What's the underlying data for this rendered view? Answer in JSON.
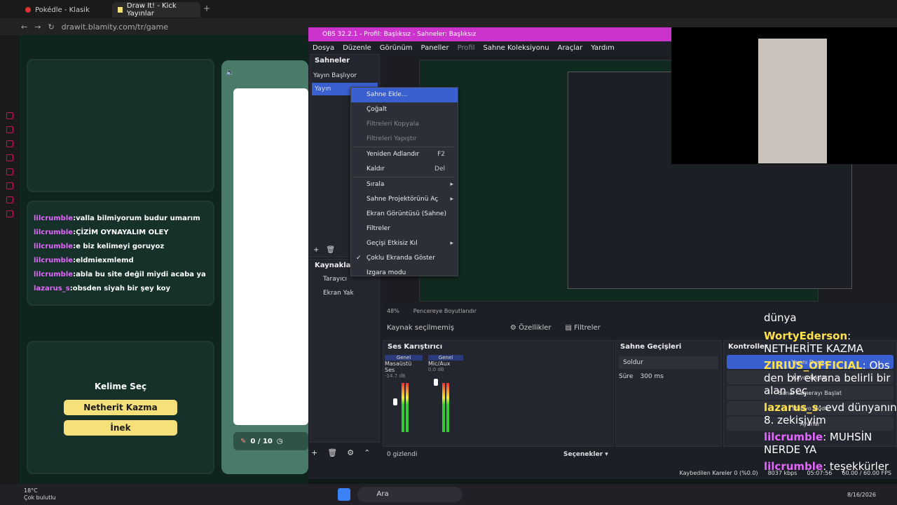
{
  "browser": {
    "tabs": [
      {
        "label": "Pokédle - Klasik"
      },
      {
        "label": "Draw It! - Kick Yayınlar"
      }
    ],
    "url": "drawit.blamity.com/tr/game"
  },
  "game": {
    "chat": [
      {
        "user": "lilcrumble",
        "text": "valla bilmiyorum budur umarım"
      },
      {
        "user": "lilcrumble",
        "text": "ÇİZİM OYNAYALIM OLEY"
      },
      {
        "user": "lilcrumble",
        "text": "e biz kelimeyi goruyoz"
      },
      {
        "user": "lilcrumble",
        "text": "eldmiexmlemd"
      },
      {
        "user": "lilcrumble",
        "text": "abla bu site değil miydi acaba ya"
      },
      {
        "user": "lazarus_s",
        "text": "obsden siyah bir şey koy"
      }
    ],
    "choose_title": "Kelime Seç",
    "words": [
      "Netherit Kazma",
      "İnek"
    ],
    "counter": "0 / 10"
  },
  "obs": {
    "title": "OBS 32.2.1 - Profil: Başlıksız - Sahneler: Başlıksız",
    "menu": [
      "Dosya",
      "Düzenle",
      "Görünüm",
      "Paneller",
      "Profil",
      "Sahne Koleksiyonu",
      "Araçlar",
      "Yardım"
    ],
    "scenes_title": "Sahneler",
    "scenes": [
      "Yayın Başlıyor",
      "Yayın"
    ],
    "sources_title": "Kaynaklar",
    "sources": [
      "Tarayıcı",
      "Ekran Yak"
    ],
    "context_menu": [
      {
        "label": "Sahne Ekle...",
        "state": "sel"
      },
      {
        "label": "Çoğalt"
      },
      {
        "label": "Filtreleri Kopyala",
        "state": "dis"
      },
      {
        "label": "Filtreleri Yapıştır",
        "state": "dis"
      },
      {
        "label": "Yeniden Adlandır",
        "shortcut": "F2"
      },
      {
        "label": "Kaldır",
        "shortcut": "Del"
      },
      {
        "label": "Sırala",
        "submenu": true
      },
      {
        "label": "Sahne Projektörünü Aç",
        "submenu": true
      },
      {
        "label": "Ekran Görüntüsü (Sahne)"
      },
      {
        "label": "Filtreler"
      },
      {
        "label": "Geçişi Etkisiz Kıl",
        "submenu": true
      },
      {
        "label": "Çoklu Ekranda Göster",
        "check": true
      },
      {
        "label": "Izgara modu"
      }
    ],
    "zoom": "48%",
    "fit": "Pencereye Boyutlandır",
    "no_source": "Kaynak seçilmemiş",
    "props": "Özellikler",
    "filters": "Filtreler",
    "mixer_title": "Ses Karıştırıcı",
    "mixer": [
      {
        "group": "Genel",
        "name": "Masaüstü Ses",
        "db": "-14.7 dB"
      },
      {
        "group": "Genel",
        "name": "Mic/Aux",
        "db": "0.0 dB"
      }
    ],
    "hidden": "0 gizlendi",
    "options": "Seçenekler",
    "transitions_title": "Sahne Geçişleri",
    "transition": "Soldur",
    "duration_label": "Süre",
    "duration": "300 ms",
    "controls_title": "Kontroller",
    "controls": [
      "Yayını Durdur",
      "Kaydı Başlat",
      "Sanal Kamerayı Başlat",
      "Stüdyo Modu",
      "Ayarlar"
    ],
    "status": {
      "dropped": "Kaybedilen Kareler 0 (%0.0)",
      "kbps": "8037 kbps",
      "time": "05:07:56",
      "fps": "60.00 / 60.00 FPS"
    }
  },
  "overlay_chat": [
    {
      "user": "",
      "text": "dünya"
    },
    {
      "user": "WortyEderson",
      "text": "NETHERİTE KAZMA",
      "color": "yellow"
    },
    {
      "user": "ZIRIUS_OFFICIAL",
      "text": "Obs den bir ekrana belirli bir alan seç",
      "color": "yellow"
    },
    {
      "user": "lazarus_s",
      "text": "evd dünyanın 8. zekisiyim",
      "color": "yellow"
    },
    {
      "user": "lilcrumble",
      "text": "MUHSİN NERDE YA",
      "color": "pink"
    },
    {
      "user": "lilcrumble",
      "text": "teşekkürler",
      "color": "pink"
    }
  ],
  "taskbar": {
    "weather_temp": "18°C",
    "weather_desc": "Çok bulutlu",
    "search": "Ara",
    "date": "8/16/2026"
  }
}
